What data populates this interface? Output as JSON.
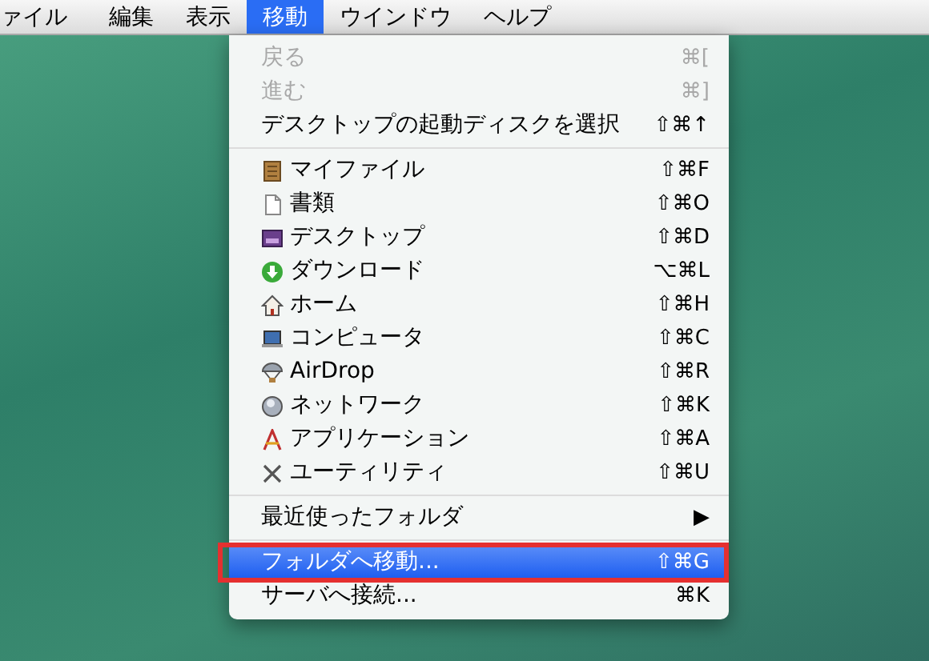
{
  "menubar": {
    "items": [
      {
        "label": "ァイル",
        "selected": false
      },
      {
        "label": "編集",
        "selected": false
      },
      {
        "label": "表示",
        "selected": false
      },
      {
        "label": "移動",
        "selected": true
      },
      {
        "label": "ウインドウ",
        "selected": false
      },
      {
        "label": "ヘルプ",
        "selected": false
      }
    ]
  },
  "menu": {
    "sections": [
      [
        {
          "label": "戻る",
          "shortcut": "⌘[",
          "disabled": true,
          "selected": false
        },
        {
          "label": "進む",
          "shortcut": "⌘]",
          "disabled": true,
          "selected": false
        },
        {
          "label": "デスクトップの起動ディスクを選択",
          "shortcut": "⇧⌘↑",
          "disabled": false,
          "selected": false
        }
      ],
      [
        {
          "label": "マイファイル",
          "shortcut": "⇧⌘F",
          "disabled": false,
          "selected": false
        },
        {
          "label": "書類",
          "shortcut": "⇧⌘O",
          "disabled": false,
          "selected": false
        },
        {
          "label": "デスクトップ",
          "shortcut": "⇧⌘D",
          "disabled": false,
          "selected": false
        },
        {
          "label": "ダウンロード",
          "shortcut": "⌥⌘L",
          "disabled": false,
          "selected": false
        },
        {
          "label": "ホーム",
          "shortcut": "⇧⌘H",
          "disabled": false,
          "selected": false
        },
        {
          "label": "コンピュータ",
          "shortcut": "⇧⌘C",
          "disabled": false,
          "selected": false
        },
        {
          "label": "AirDrop",
          "shortcut": "⇧⌘R",
          "disabled": false,
          "selected": false
        },
        {
          "label": "ネットワーク",
          "shortcut": "⇧⌘K",
          "disabled": false,
          "selected": false
        },
        {
          "label": "アプリケーション",
          "shortcut": "⇧⌘A",
          "disabled": false,
          "selected": false
        },
        {
          "label": "ユーティリティ",
          "shortcut": "⇧⌘U",
          "disabled": false,
          "selected": false
        }
      ],
      [
        {
          "label": "最近使ったフォルダ",
          "shortcut": "▶",
          "disabled": false,
          "selected": false
        }
      ],
      [
        {
          "label": "フォルダへ移動...",
          "shortcut": "⇧⌘G",
          "disabled": false,
          "selected": true
        },
        {
          "label": "サーバへ接続...",
          "shortcut": "⌘K",
          "disabled": false,
          "selected": false
        }
      ]
    ]
  }
}
